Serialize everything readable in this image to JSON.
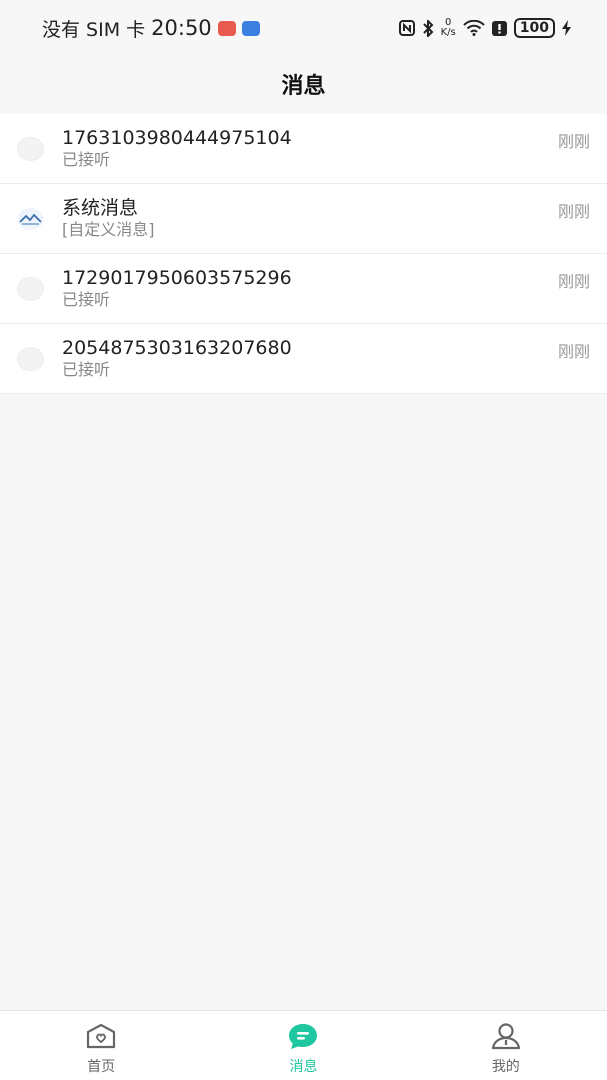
{
  "status_bar": {
    "carrier": "没有 SIM 卡",
    "time": "20:50",
    "speed_top": "0",
    "speed_unit": "K/s",
    "battery": "100"
  },
  "header": {
    "title": "消息"
  },
  "messages": [
    {
      "title": "1763103980444975104",
      "subtitle": "已接听",
      "time": "刚刚",
      "avatar": "blank-avatar"
    },
    {
      "title": "系统消息",
      "subtitle": "[自定义消息]",
      "time": "刚刚",
      "avatar": "house-logo"
    },
    {
      "title": "1729017950603575296",
      "subtitle": "已接听",
      "time": "刚刚",
      "avatar": "blank-avatar"
    },
    {
      "title": "2054875303163207680",
      "subtitle": "已接听",
      "time": "刚刚",
      "avatar": "blank-avatar"
    }
  ],
  "tabs": [
    {
      "label": "首页",
      "icon": "home-icon",
      "active": false
    },
    {
      "label": "消息",
      "icon": "message-icon",
      "active": true
    },
    {
      "label": "我的",
      "icon": "profile-icon",
      "active": false
    }
  ],
  "colors": {
    "accent": "#1ec7a0",
    "background": "#f7f7f7",
    "inactive": "#666666"
  }
}
